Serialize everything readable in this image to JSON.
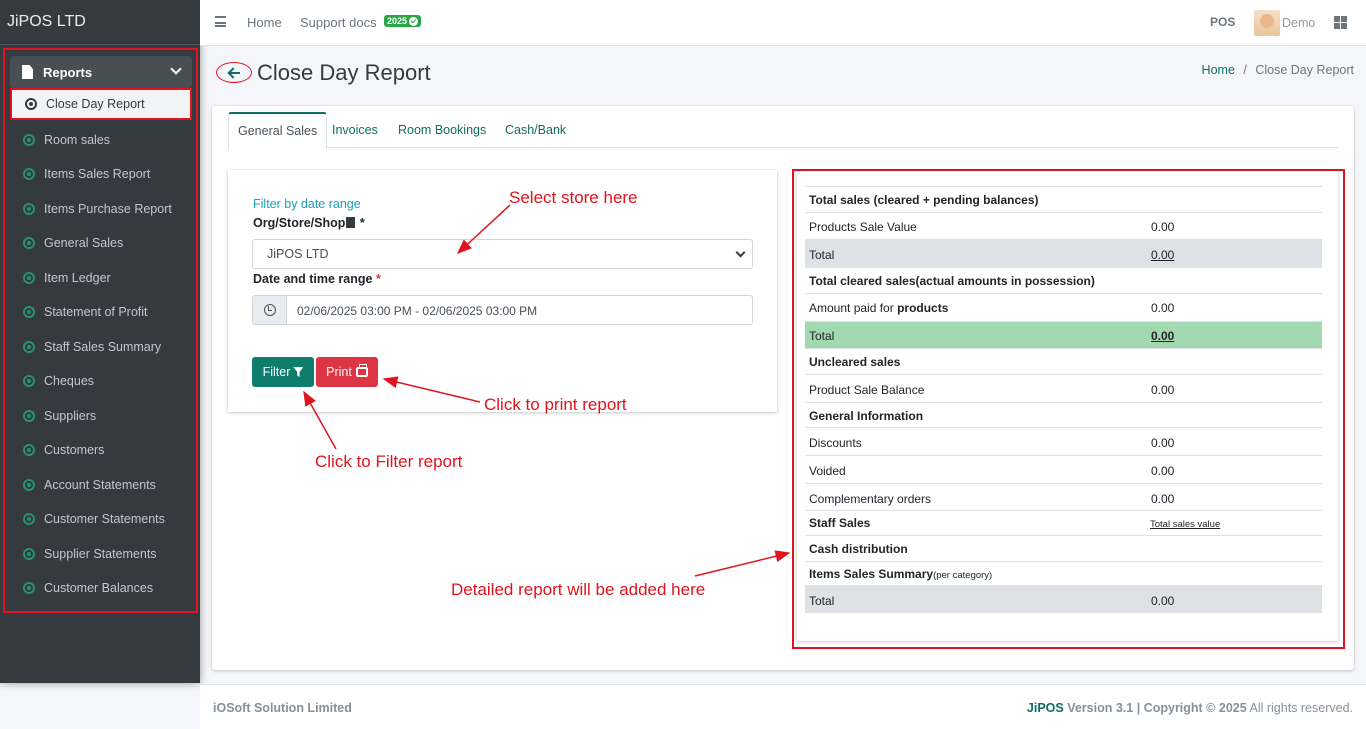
{
  "sidebar": {
    "brand": "JiPOS LTD",
    "section_label": "Reports",
    "items": [
      "Close Day Report",
      "Room sales",
      "Items Sales Report",
      "Items Purchase Report",
      "General Sales",
      "Item Ledger",
      "Statement of Profit",
      "Staff Sales Summary",
      "Cheques",
      "Suppliers",
      "Customers",
      "Account Statements",
      "Customer Statements",
      "Supplier Statements",
      "Customer Balances"
    ],
    "active_index": 0
  },
  "topbar": {
    "home": "Home",
    "support": "Support docs",
    "year_badge": "2025",
    "pos": "POS",
    "user": "Demo"
  },
  "page": {
    "title": "Close Day Report",
    "breadcrumb_home": "Home",
    "breadcrumb_sep": "/",
    "breadcrumb_current": "Close Day Report"
  },
  "tabs": [
    "General Sales",
    "Invoices",
    "Room Bookings",
    "Cash/Bank"
  ],
  "filter": {
    "title": "Filter by date range",
    "store_label": "Org/Store/Shop",
    "store_value": "JiPOS LTD",
    "date_label": "Date and time range",
    "required_mark": "*",
    "date_value": "02/06/2025 03:00 PM - 02/06/2025 03:00 PM",
    "filter_btn": "Filter",
    "print_btn": "Print"
  },
  "report": {
    "total_sales_head": "Total sales (cleared + pending balances)",
    "products_sale_value_label": "Products Sale Value",
    "products_sale_value": "0.00",
    "total_label": "Total",
    "total_sales": "0.00",
    "cleared_head": "Total cleared sales(actual amounts in possession)",
    "amount_paid_prefix": "Amount paid for",
    "amount_paid_bold": "products",
    "amount_paid": "0.00",
    "cleared_total": "0.00",
    "uncleared_head": "Uncleared sales",
    "product_sale_balance_label": "Product Sale Balance",
    "product_sale_balance": "0.00",
    "general_info_head": "General Information",
    "discounts_label": "Discounts",
    "discounts": "0.00",
    "voided_label": "Voided",
    "voided": "0.00",
    "complementary_label": "Complementary orders",
    "complementary": "0.00",
    "staff_sales_head": "Staff Sales",
    "staff_sales_link": "Total sales value",
    "cash_distribution_head": "Cash distribution",
    "items_summary_head": "Items Sales Summary",
    "items_summary_sub": "(per category)",
    "items_total": "0.00"
  },
  "annotations": {
    "select_store": "Select store here",
    "print": "Click to print report",
    "filter": "Click to Filter report",
    "detailed": "Detailed report will be added here"
  },
  "footer": {
    "company": "iOSoft Solution Limited",
    "brand": "JiPOS",
    "version": "Version 3.1",
    "sep": "|",
    "copyright": "Copyright © 2025",
    "rights": "All rights reserved."
  },
  "colors": {
    "accent": "#0f6d64",
    "sidebar_bg": "#343a40",
    "annotation_red": "#e0141e",
    "danger": "#dc3545",
    "success_row": "#a3d9b1"
  }
}
